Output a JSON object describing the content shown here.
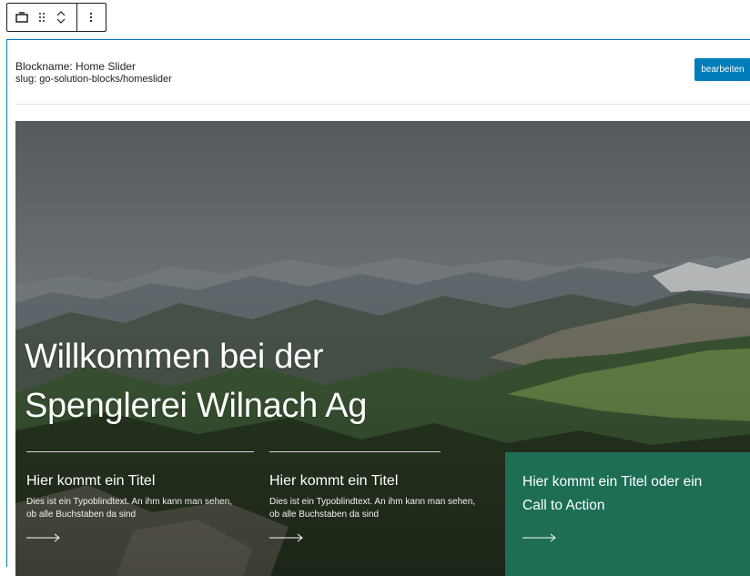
{
  "toolbar": {
    "icons": [
      "block-type-icon",
      "drag-handle-icon",
      "move-up-icon",
      "move-down-icon",
      "more-options-icon"
    ]
  },
  "block": {
    "name_line": "Blockname: Home Slider",
    "slug_line": "slug: go-solution-blocks/homeslider",
    "edit_label": "bearbeiten"
  },
  "hero": {
    "title_line1": "Willkommen bei der",
    "title_line2": "Spenglerei Wilnach Ag",
    "teasers": [
      {
        "title": "Hier kommt ein Titel",
        "text_line1": "Dies ist ein Typoblindtext. An ihm kann man sehen,",
        "text_line2": "ob alle Buchstaben da sind"
      },
      {
        "title": "Hier kommt ein Titel",
        "text_line1": "Dies ist ein Typoblindtext. An ihm kann man sehen,",
        "text_line2": "ob alle Buchstaben da sind"
      }
    ],
    "cta": {
      "title_line1": "Hier kommt ein Titel oder ein",
      "title_line2": "Call to Action"
    }
  },
  "colors": {
    "accent": "#007cba",
    "cta_green": "#1d6e55"
  }
}
